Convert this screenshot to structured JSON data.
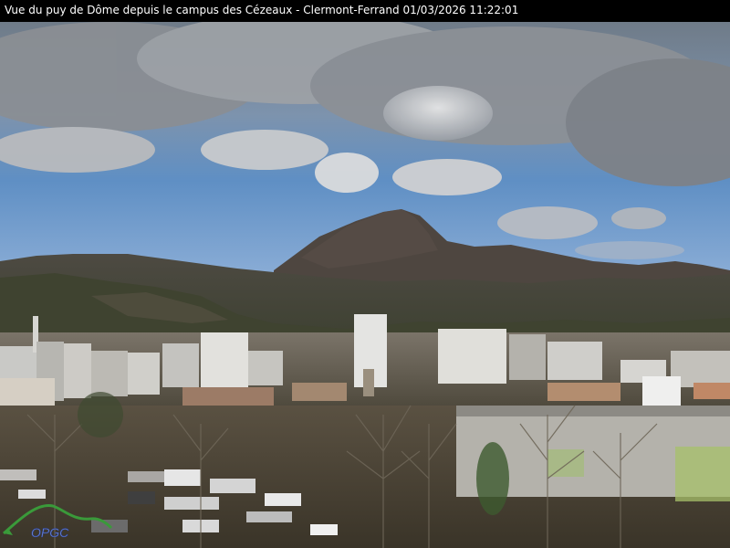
{
  "caption": {
    "title": "Vue du puy de Dôme depuis le campus des Cézeaux - Clermont-Ferrand",
    "datetime": "01/03/2026 11:22:01"
  },
  "logo": {
    "text": "OPGC",
    "color": "#3a9a3a"
  },
  "scene": {
    "subject": "puy-de-dome-mountain",
    "sky_color": "#5f8fc4",
    "cloud_color": "#d9d9d9"
  }
}
